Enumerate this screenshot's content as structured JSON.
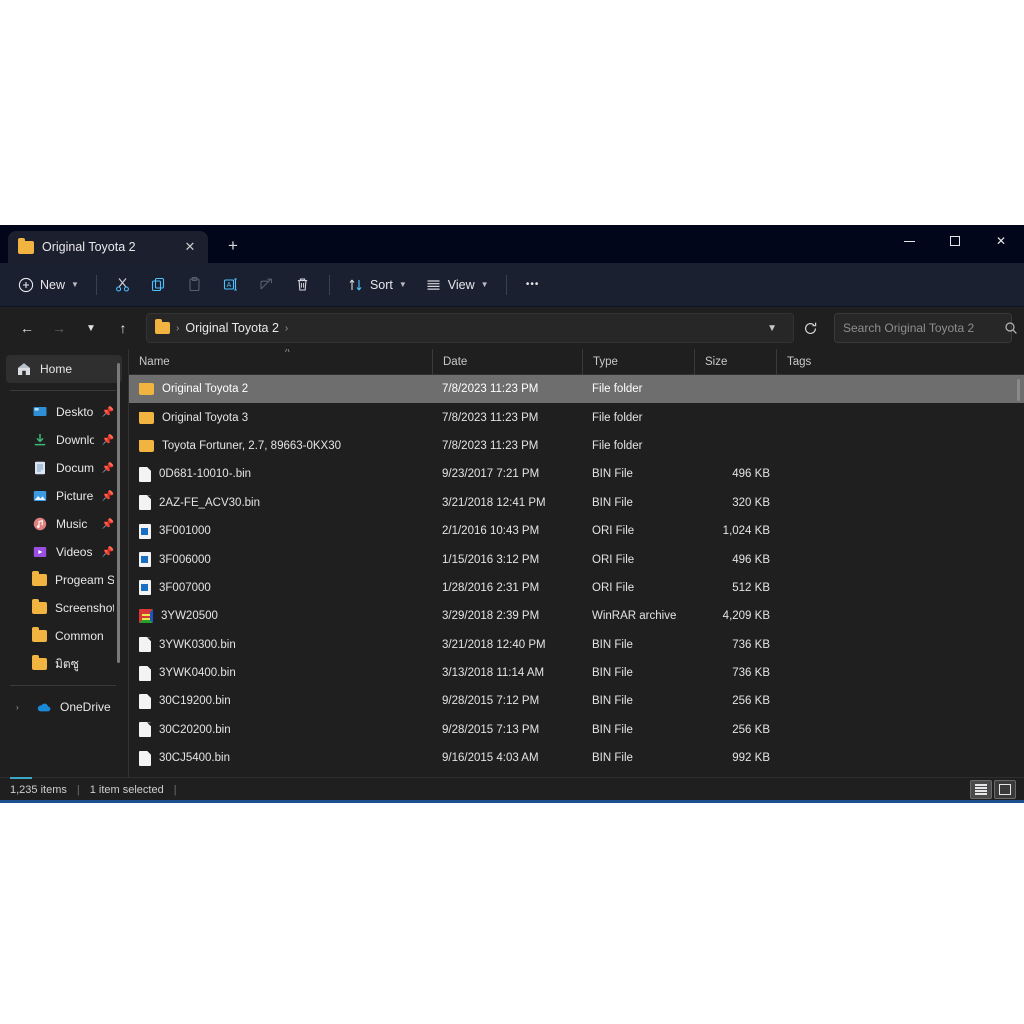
{
  "window": {
    "tab_title": "Original Toyota 2",
    "tab_close_icon": "close-icon",
    "new_tab_icon": "plus-icon",
    "minimize_icon": "minimize-icon",
    "maximize_icon": "maximize-icon",
    "close_icon": "close-icon"
  },
  "toolbar": {
    "new_label": "New",
    "sort_label": "Sort",
    "view_label": "View",
    "more_label": "•••",
    "icons": {
      "new": "plus-circle-icon",
      "cut": "scissors-icon",
      "copy": "copy-icon",
      "paste": "paste-icon",
      "rename": "rename-icon",
      "share": "share-icon",
      "delete": "trash-icon",
      "sort": "sort-arrows-icon",
      "view": "list-lines-icon",
      "more": "ellipsis-icon"
    }
  },
  "address": {
    "back_icon": "arrow-left-icon",
    "forward_icon": "arrow-right-icon",
    "recent_icon": "chevron-down-icon",
    "up_icon": "arrow-up-icon",
    "folder_icon": "folder-icon",
    "crumb": "Original Toyota 2",
    "separator": "›",
    "dropdown_icon": "chevron-down-icon",
    "refresh_icon": "refresh-icon"
  },
  "search": {
    "placeholder": "Search Original Toyota 2",
    "value": "",
    "icon": "search-icon"
  },
  "sidebar": {
    "home": {
      "label": "Home",
      "icon": "home-icon",
      "selected": true
    },
    "items": [
      {
        "label": "Desktop",
        "icon": "desktop-icon",
        "pinned": true
      },
      {
        "label": "Downloads",
        "icon": "download-icon",
        "pinned": true
      },
      {
        "label": "Documents",
        "icon": "documents-icon",
        "pinned": true
      },
      {
        "label": "Pictures",
        "icon": "pictures-icon",
        "pinned": true
      },
      {
        "label": "Music",
        "icon": "music-icon",
        "pinned": true
      },
      {
        "label": "Videos",
        "icon": "videos-icon",
        "pinned": true
      },
      {
        "label": "Progeam Service",
        "icon": "folder-icon",
        "pinned": false
      },
      {
        "label": "Screenshots",
        "icon": "folder-icon",
        "pinned": false
      },
      {
        "label": "Common",
        "icon": "folder-icon",
        "pinned": false
      },
      {
        "label": "มิตซู",
        "icon": "folder-icon",
        "pinned": false
      }
    ],
    "onedrive": {
      "label": "OneDrive",
      "icon": "onedrive-cloud-icon",
      "expander": "›"
    },
    "pin_icon": "pin-icon"
  },
  "columns": [
    {
      "key": "name",
      "label": "Name"
    },
    {
      "key": "date",
      "label": "Date"
    },
    {
      "key": "type",
      "label": "Type"
    },
    {
      "key": "size",
      "label": "Size"
    },
    {
      "key": "tags",
      "label": "Tags"
    }
  ],
  "sort_indicator": "∧",
  "files": [
    {
      "name": "Original Toyota 2",
      "date": "7/8/2023 11:23 PM",
      "type": "File folder",
      "size": "",
      "tags": "",
      "icon": "folder-icon",
      "selected": true
    },
    {
      "name": "Original Toyota 3",
      "date": "7/8/2023 11:23 PM",
      "type": "File folder",
      "size": "",
      "tags": "",
      "icon": "folder-icon",
      "selected": false
    },
    {
      "name": "Toyota Fortuner, 2.7, 89663-0KX30",
      "date": "7/8/2023 11:23 PM",
      "type": "File folder",
      "size": "",
      "tags": "",
      "icon": "folder-icon",
      "selected": false
    },
    {
      "name": "0D681-10010-.bin",
      "date": "9/23/2017 7:21 PM",
      "type": "BIN File",
      "size": "496 KB",
      "tags": "",
      "icon": "bin-file-icon",
      "selected": false
    },
    {
      "name": "2AZ-FE_ACV30.bin",
      "date": "3/21/2018 12:41 PM",
      "type": "BIN File",
      "size": "320 KB",
      "tags": "",
      "icon": "bin-file-icon",
      "selected": false
    },
    {
      "name": "3F001000",
      "date": "2/1/2016 10:43 PM",
      "type": "ORI File",
      "size": "1,024 KB",
      "tags": "",
      "icon": "ori-file-icon",
      "selected": false
    },
    {
      "name": "3F006000",
      "date": "1/15/2016 3:12 PM",
      "type": "ORI File",
      "size": "496 KB",
      "tags": "",
      "icon": "ori-file-icon",
      "selected": false
    },
    {
      "name": "3F007000",
      "date": "1/28/2016 2:31 PM",
      "type": "ORI File",
      "size": "512 KB",
      "tags": "",
      "icon": "ori-file-icon",
      "selected": false
    },
    {
      "name": "3YW20500",
      "date": "3/29/2018 2:39 PM",
      "type": "WinRAR archive",
      "size": "4,209 KB",
      "tags": "",
      "icon": "winrar-archive-icon",
      "selected": false
    },
    {
      "name": "3YWK0300.bin",
      "date": "3/21/2018 12:40 PM",
      "type": "BIN File",
      "size": "736 KB",
      "tags": "",
      "icon": "bin-file-icon",
      "selected": false
    },
    {
      "name": "3YWK0400.bin",
      "date": "3/13/2018 11:14 AM",
      "type": "BIN File",
      "size": "736 KB",
      "tags": "",
      "icon": "bin-file-icon",
      "selected": false
    },
    {
      "name": "30C19200.bin",
      "date": "9/28/2015 7:12 PM",
      "type": "BIN File",
      "size": "256 KB",
      "tags": "",
      "icon": "bin-file-icon",
      "selected": false
    },
    {
      "name": "30C20200.bin",
      "date": "9/28/2015 7:13 PM",
      "type": "BIN File",
      "size": "256 KB",
      "tags": "",
      "icon": "bin-file-icon",
      "selected": false
    },
    {
      "name": "30CJ5400.bin",
      "date": "9/16/2015 4:03 AM",
      "type": "BIN File",
      "size": "992 KB",
      "tags": "",
      "icon": "bin-file-icon",
      "selected": false
    }
  ],
  "status": {
    "item_count": "1,235 items",
    "selection": "1 item selected",
    "separator": "|",
    "details_view_icon": "details-view-icon",
    "large_icons_view_icon": "large-icons-view-icon"
  },
  "colors": {
    "window_bg": "#1f1f1f",
    "titlebar_bg": "#02061a",
    "toolbar_bg": "#1b2031",
    "folder_yellow": "#f2b441",
    "selection_grey": "#6e6e6e",
    "accent_blue": "#4cc2ff"
  }
}
